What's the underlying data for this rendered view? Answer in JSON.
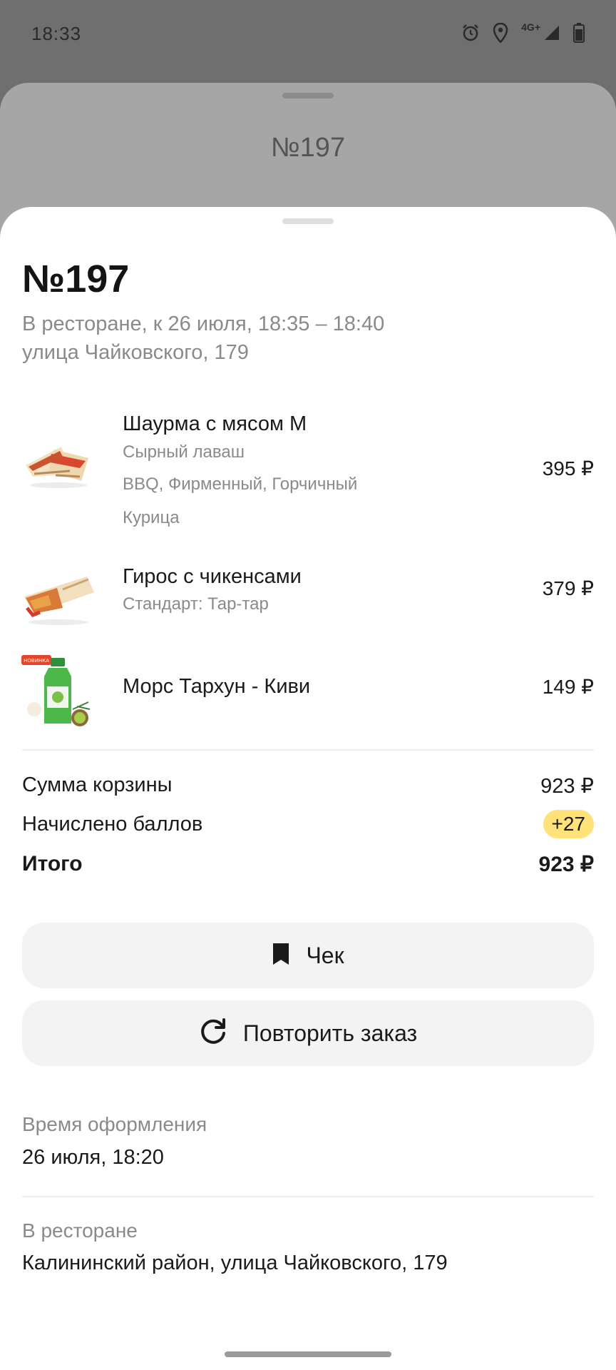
{
  "status_bar": {
    "time": "18:33",
    "network": "4G+"
  },
  "back_sheet": {
    "title": "№197"
  },
  "order": {
    "title": "№197",
    "pickup_line": "В ресторане, к 26 июля, 18:35 – 18:40",
    "address_line": "улица Чайковского, 179",
    "items": [
      {
        "name": "Шаурма с мясом М",
        "modifiers": [
          "Сырный лаваш",
          "BBQ, Фирменный, Горчичный",
          "Курица"
        ],
        "price": "395 ₽",
        "image": "shawarma-image"
      },
      {
        "name": "Гирос с чикенсами",
        "modifiers": [
          "Стандарт: Тар-тар"
        ],
        "price": "379 ₽",
        "image": "gyros-image"
      },
      {
        "name": "Морс Тархун - Киви",
        "modifiers": [],
        "price": "149 ₽",
        "image": "drink-image",
        "badge": "НОВИНКА"
      }
    ],
    "summary": {
      "cart_label": "Сумма корзины",
      "cart_value": "923 ₽",
      "points_label": "Начислено баллов",
      "points_value": "+27",
      "total_label": "Итого",
      "total_value": "923 ₽"
    },
    "buttons": {
      "receipt": "Чек",
      "repeat": "Повторить заказ"
    },
    "info": {
      "created_label": "Время оформления",
      "created_value": "26 июля, 18:20",
      "place_label": "В ресторане",
      "place_value": "Калининский район, улица Чайковского, 179"
    }
  },
  "colors": {
    "points_badge": "#ffe27a",
    "button_bg": "#f3f3f3",
    "secondary_text": "#8a8a8a"
  }
}
